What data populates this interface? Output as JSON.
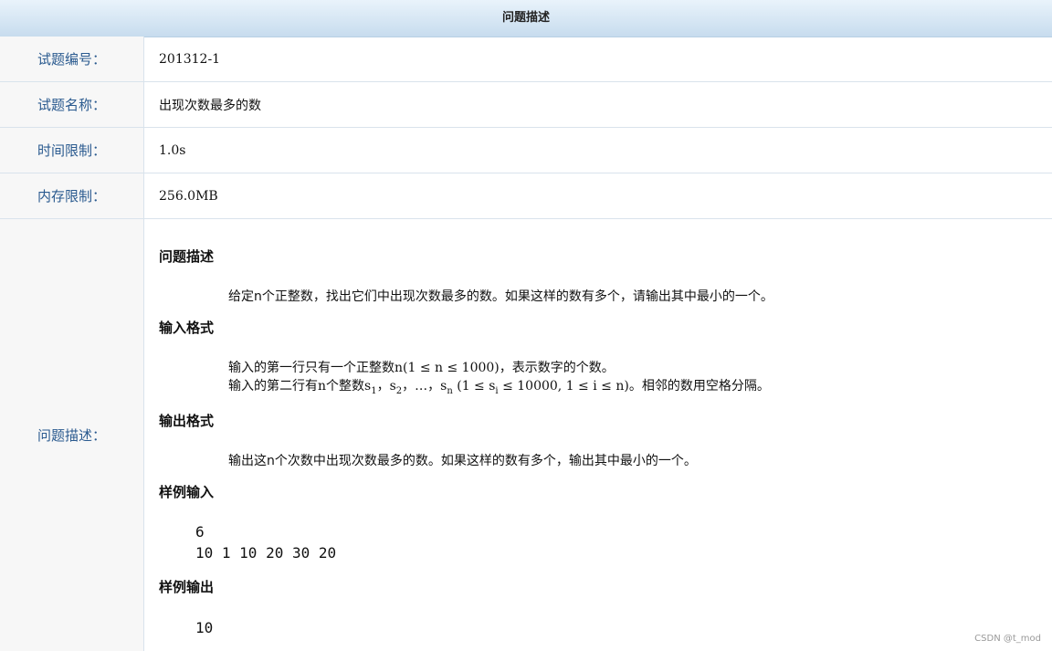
{
  "header": {
    "title": "问题描述"
  },
  "rows": [
    {
      "label": "试题编号：",
      "value": "201312-1"
    },
    {
      "label": "试题名称：",
      "value": "出现次数最多的数"
    },
    {
      "label": "时间限制：",
      "value": "1.0s"
    },
    {
      "label": "内存限制：",
      "value": "256.0MB"
    }
  ],
  "description": {
    "label": "问题描述：",
    "section1_title": "问题描述",
    "section1_text": "给定n个正整数，找出它们中出现次数最多的数。如果这样的数有多个，请输出其中最小的一个。",
    "section2_title": "输入格式",
    "section2_line1": "输入的第一行只有一个正整数n(1 ≤ n ≤ 1000)，表示数字的个数。",
    "section2_line2_prefix": "输入的第二行有n个整数s",
    "sub1": "1",
    "sep1": "，s",
    "sub2": "2",
    "sep2": "，…，s",
    "subn": "n",
    "section2_line2_mid": " (1 ≤ s",
    "subi": "i",
    "section2_line2_suffix": " ≤ 10000, 1 ≤ i ≤ n)。相邻的数用空格分隔。",
    "section3_title": "输出格式",
    "section3_text": "输出这n个次数中出现次数最多的数。如果这样的数有多个，输出其中最小的一个。",
    "section4_title": "样例输入",
    "sample_input_line1": "6",
    "sample_input_line2": "10 1 10 20 30 20",
    "section5_title": "样例输出",
    "sample_output": "10"
  },
  "watermark": "CSDN @t_mod"
}
